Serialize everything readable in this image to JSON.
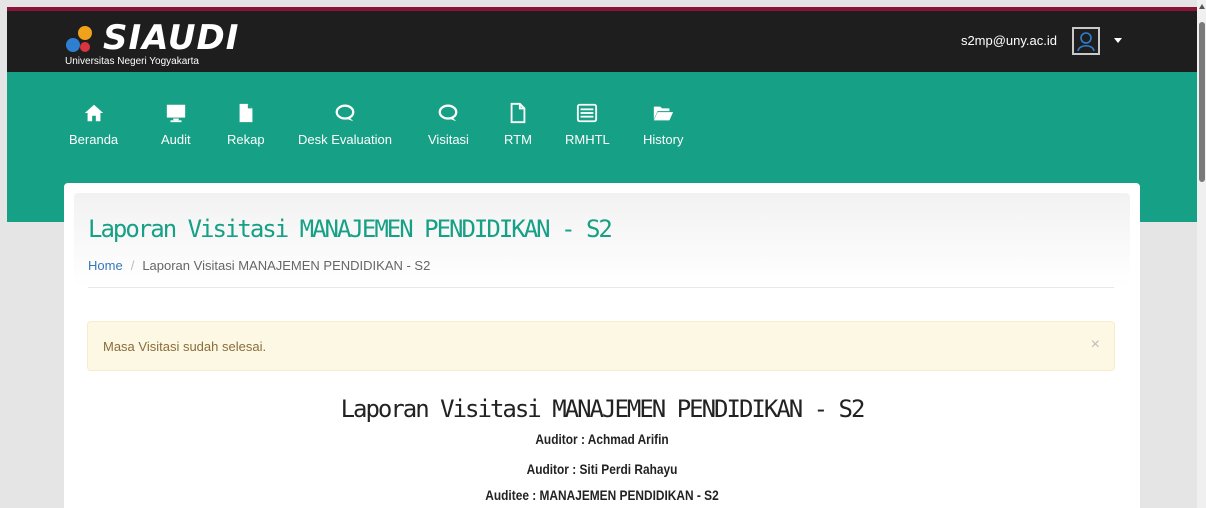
{
  "header": {
    "logo_text": "SIAUDI",
    "logo_subtitle": "Universitas Negeri Yogyakarta",
    "user_email": "s2mp@uny.ac.id"
  },
  "nav": [
    {
      "label": "Beranda",
      "icon": "home-icon"
    },
    {
      "label": "Audit",
      "icon": "monitor-icon"
    },
    {
      "label": "Rekap",
      "icon": "file-icon"
    },
    {
      "label": "Desk Evaluation",
      "icon": "chat-icon"
    },
    {
      "label": "Visitasi",
      "icon": "chat-icon"
    },
    {
      "label": "RTM",
      "icon": "file-outline-icon"
    },
    {
      "label": "RMHTL",
      "icon": "list-box-icon"
    },
    {
      "label": "History",
      "icon": "folder-open-icon"
    }
  ],
  "page": {
    "title": "Laporan Visitasi MANAJEMEN PENDIDIKAN - S2",
    "breadcrumb_home": "Home",
    "breadcrumb_sep": "/",
    "breadcrumb_current": "Laporan Visitasi MANAJEMEN PENDIDIKAN - S2"
  },
  "alert": {
    "message": "Masa Visitasi sudah selesai.",
    "close": "×"
  },
  "report": {
    "title": "Laporan Visitasi MANAJEMEN PENDIDIKAN - S2",
    "auditor_1": "Auditor : Achmad Arifin",
    "auditor_2": "Auditor : Siti Perdi Rahayu",
    "auditee": "Auditee : MANAJEMEN PENDIDIKAN - S2"
  },
  "colors": {
    "nav_bg": "#16a085",
    "topbar_bg": "#1e1e1e",
    "accent_strip": "#8a1538",
    "title_color": "#16a085",
    "alert_bg": "#fcf8e3"
  }
}
